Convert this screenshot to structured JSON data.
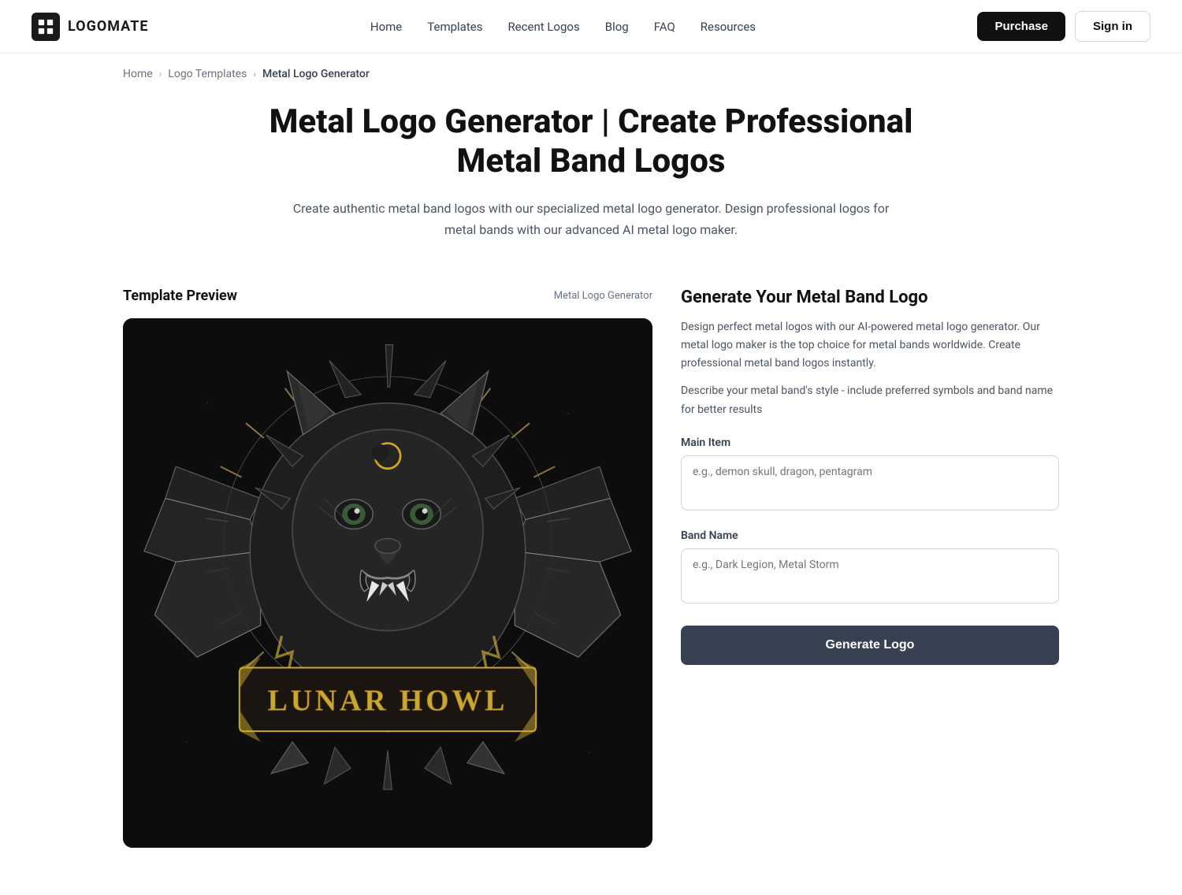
{
  "nav": {
    "logo_text": "LOGOMATE",
    "links": [
      {
        "label": "Home",
        "href": "#"
      },
      {
        "label": "Templates",
        "href": "#"
      },
      {
        "label": "Recent Logos",
        "href": "#"
      },
      {
        "label": "Blog",
        "href": "#"
      },
      {
        "label": "FAQ",
        "href": "#"
      },
      {
        "label": "Resources",
        "href": "#"
      }
    ],
    "purchase_label": "Purchase",
    "signin_label": "Sign in"
  },
  "breadcrumb": {
    "home": "Home",
    "logo_templates": "Logo Templates",
    "current": "Metal Logo Generator"
  },
  "hero": {
    "title": "Metal Logo Generator | Create Professional Metal Band Logos",
    "description": "Create authentic metal band logos with our specialized metal logo generator. Design professional logos for metal bands with our advanced AI metal logo maker."
  },
  "left_panel": {
    "title": "Template Preview",
    "template_label": "Metal Logo Generator"
  },
  "right_panel": {
    "title": "Generate Your Metal Band Logo",
    "description": "Design perfect metal logos with our AI-powered metal logo generator. Our metal logo maker is the top choice for metal bands worldwide. Create professional metal band logos instantly.",
    "hint": "Describe your metal band's style - include preferred symbols and band name for better results",
    "main_item_label": "Main Item",
    "main_item_placeholder": "e.g., demon skull, dragon, pentagram",
    "band_name_label": "Band Name",
    "band_name_placeholder": "e.g., Dark Legion, Metal Storm",
    "generate_button": "Generate Logo"
  }
}
